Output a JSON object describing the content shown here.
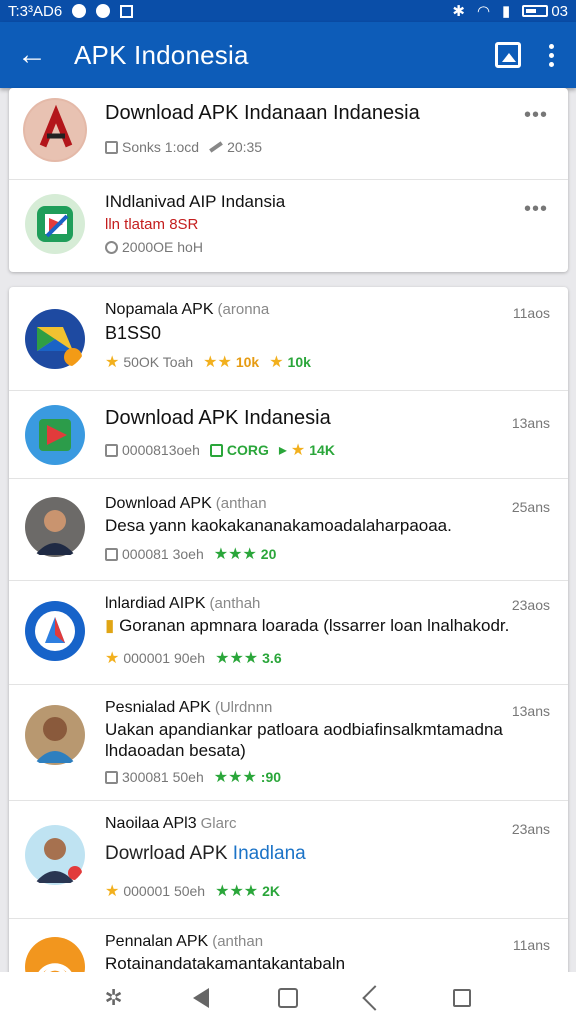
{
  "status_bar": {
    "time": "T:3³AD6",
    "battery_text": "03"
  },
  "app_bar": {
    "title": "APK Indonesia"
  },
  "featured": [
    {
      "title": "Download APK Indanaan Indanesia",
      "meta1": "Sonks 1:ocd",
      "meta2": "20:35"
    },
    {
      "title": "INdlanivad AIP Indansia",
      "subtitle": "lln tlatam 8SR",
      "meta": "2000OE hoH"
    }
  ],
  "list": [
    {
      "name": "Nopamala APK",
      "tag": "(aronna",
      "body": "B1SS0",
      "time": "11aos",
      "m1": "50OK Toah",
      "m2": "10k",
      "m3": "10k"
    },
    {
      "title": "Download APK Indanesia",
      "time": "13ans",
      "m1": "0000813oeh",
      "m2": "CORG",
      "m3": "14K"
    },
    {
      "name": "Download APK",
      "tag": "(anthan",
      "body": "Desa yann kaokakananakamoadalaharpaoaa.",
      "time": "25ans",
      "m1": "000081 3oeh",
      "m2": "20"
    },
    {
      "name": "lnlardiad AIPK",
      "tag": "(anthah",
      "body": "Goranan apmnara loarada (lssarrer loan lnalhakodr.",
      "time": "23aos",
      "m1": "000001 90eh",
      "m2": "3.6"
    },
    {
      "name": "Pesnialad APK",
      "tag": "(Ulrdnnn",
      "body": "Uakan apandiankar patloara aodbiafinsalkmtamadna lhdaoadan besata)",
      "time": "13ans",
      "m1": "300081 50eh",
      "m2": ":90"
    },
    {
      "name": "Naoilaa APl3",
      "tag": "Glarc",
      "body_prefix": "Dowrload APK",
      "body_link": "Inadlana",
      "time": "23ans",
      "m1": "000001 50eh",
      "m2": "2K"
    },
    {
      "name": "Pennalan APK",
      "tag": "(anthan",
      "body": "Rotainandatakamantakantabaln",
      "time": "11ans"
    }
  ],
  "icons": [
    "back-arrow-icon",
    "image-icon",
    "more-vert-icon",
    "star-icon",
    "clock-icon",
    "edit-icon",
    "box-icon"
  ]
}
